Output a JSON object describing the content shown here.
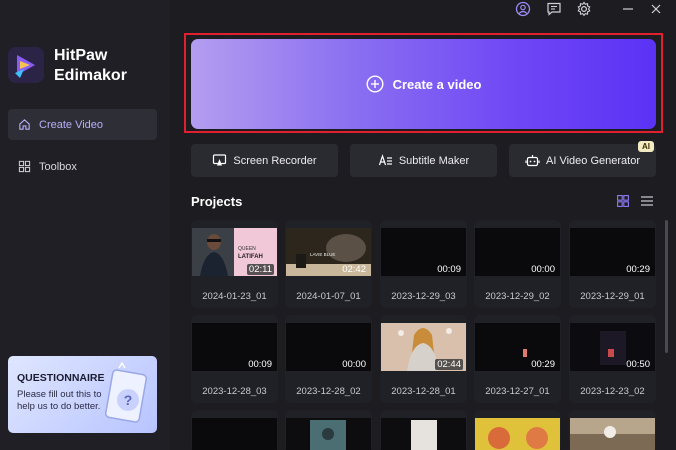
{
  "app": {
    "name_line1": "HitPaw",
    "name_line2": "Edimakor"
  },
  "sidebar": {
    "items": [
      {
        "label": "Create Video",
        "icon": "home-icon",
        "active": true
      },
      {
        "label": "Toolbox",
        "icon": "grid-icon",
        "active": false
      }
    ],
    "questionnaire": {
      "title": "QUESTIONNAIRE",
      "subtitle": "Please fill out this to help us to do better."
    }
  },
  "topbar": {
    "icons": [
      "account-icon",
      "feedback-icon",
      "settings-icon",
      "minimize-icon",
      "close-icon"
    ]
  },
  "main": {
    "create_label": "Create a video",
    "tools": [
      {
        "label": "Screen Recorder",
        "icon": "screen-recorder-icon"
      },
      {
        "label": "Subtitle Maker",
        "icon": "subtitle-icon"
      },
      {
        "label": "AI Video Generator",
        "icon": "ai-robot-icon",
        "badge": "AI"
      }
    ],
    "projects_title": "Projects",
    "projects": [
      {
        "name": "2024-01-23_01",
        "duration": "02:11"
      },
      {
        "name": "2024-01-07_01",
        "duration": "02:42"
      },
      {
        "name": "2023-12-29_03",
        "duration": "00:09"
      },
      {
        "name": "2023-12-29_02",
        "duration": "00:00"
      },
      {
        "name": "2023-12-29_01",
        "duration": "00:29"
      },
      {
        "name": "2023-12-28_03",
        "duration": "00:09"
      },
      {
        "name": "2023-12-28_02",
        "duration": "00:00"
      },
      {
        "name": "2023-12-28_01",
        "duration": "02:44"
      },
      {
        "name": "2023-12-27_01",
        "duration": "00:29"
      },
      {
        "name": "2023-12-23_02",
        "duration": "00:50"
      }
    ],
    "thumbnail_text": {
      "p1_caption": "LATIFAH",
      "p2_caption": "LAVIE BLUE"
    }
  },
  "colors": {
    "accent": "#7b5cf5",
    "highlight_border": "#e0202e",
    "background": "#1c1c21"
  }
}
